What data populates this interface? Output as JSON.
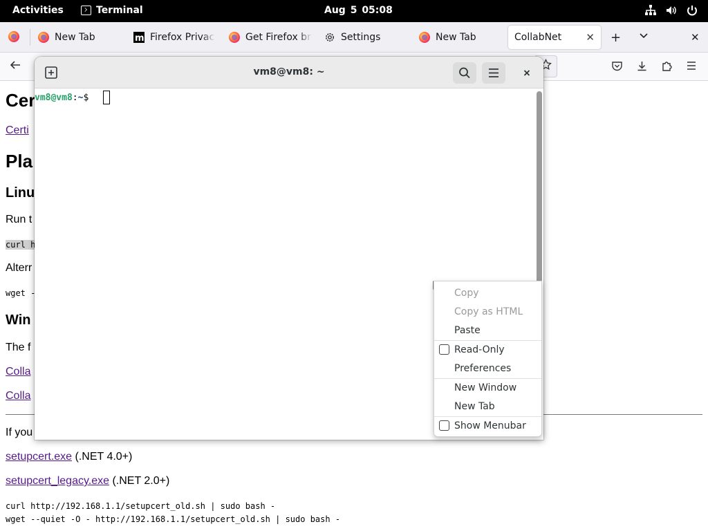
{
  "topbar": {
    "activities": "Activities",
    "app_name": "Terminal",
    "clock": "Aug 5  05:08",
    "icons": [
      "network-icon",
      "volume-icon",
      "power-icon"
    ]
  },
  "browser": {
    "tabs": [
      {
        "label": "New Tab",
        "icon": "firefox-icon"
      },
      {
        "label": "Firefox Privacy",
        "icon": "mozilla-icon"
      },
      {
        "label": "Get Firefox bro",
        "icon": "firefox-icon"
      },
      {
        "label": "Settings",
        "icon": "gear-icon"
      },
      {
        "label": "New Tab",
        "icon": "firefox-icon"
      },
      {
        "label": "CollabNet",
        "icon": null,
        "active": true
      }
    ],
    "page": {
      "h1": "Cer",
      "link1": "Certi",
      "h2_platform": "Pla",
      "h3_linux": "Linu",
      "run_text": "Run t",
      "curl_snip": "curl h",
      "alt_text": "Alterr",
      "wget_snip": "wget -",
      "h3_windows": "Win",
      "the_text": "The f",
      "collab1": "Colla",
      "collab2": "Colla",
      "if_text": "If you",
      "setupcert_link": "setupcert.exe",
      "setupcert_note": " (.NET 4.0+)",
      "setupcert_legacy_link": "setupcert_legacy.exe",
      "setupcert_legacy_note": " (.NET 2.0+)",
      "cmd_curl_old": "curl http://192.168.1.1/setupcert_old.sh | sudo bash -",
      "cmd_wget_old": "wget --quiet -O - http://192.168.1.1/setupcert_old.sh | sudo bash -"
    }
  },
  "terminal": {
    "title": "vm8@vm8: ~",
    "prompt_user": "vm8@vm8",
    "prompt_sep": ":",
    "prompt_path": "~",
    "prompt_symbol": "$ "
  },
  "context_menu": {
    "copy": "Copy",
    "copy_html": "Copy as HTML",
    "paste": "Paste",
    "read_only": "Read-Only",
    "preferences": "Preferences",
    "new_window": "New Window",
    "new_tab": "New Tab",
    "show_menubar": "Show Menubar"
  }
}
